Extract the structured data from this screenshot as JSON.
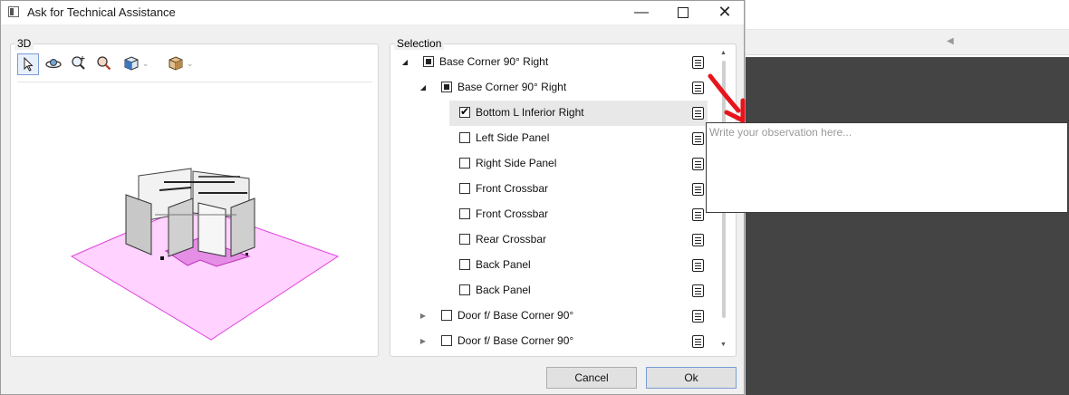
{
  "dialog": {
    "title": "Ask for Technical Assistance",
    "window_controls": [
      "minimize-icon",
      "maximize-icon",
      "close-icon"
    ]
  },
  "panel3d": {
    "label": "3D",
    "tools": [
      "select-pointer-icon",
      "orbit-icon",
      "zoom-extents-icon",
      "zoom-icon",
      "view-cube-icon",
      "box-view-icon"
    ]
  },
  "selection": {
    "label": "Selection",
    "items": [
      {
        "label": "Base Corner 90° Right",
        "level": 0,
        "expander": "expanded",
        "check": "partial"
      },
      {
        "label": "Base Corner 90° Right",
        "level": 1,
        "expander": "expanded",
        "check": "partial"
      },
      {
        "label": "Bottom L Inferior Right",
        "level": 2,
        "expander": "none",
        "check": "checked",
        "selected": true
      },
      {
        "label": "Left Side Panel",
        "level": 2,
        "expander": "none",
        "check": "unchecked"
      },
      {
        "label": "Right Side Panel",
        "level": 2,
        "expander": "none",
        "check": "unchecked"
      },
      {
        "label": "Front Crossbar",
        "level": 2,
        "expander": "none",
        "check": "unchecked"
      },
      {
        "label": "Front Crossbar",
        "level": 2,
        "expander": "none",
        "check": "unchecked"
      },
      {
        "label": "Rear Crossbar",
        "level": 2,
        "expander": "none",
        "check": "unchecked"
      },
      {
        "label": "Back Panel",
        "level": 2,
        "expander": "none",
        "check": "unchecked"
      },
      {
        "label": "Back Panel",
        "level": 2,
        "expander": "none",
        "check": "unchecked"
      },
      {
        "label": "Door f/ Base Corner 90°",
        "level": 1,
        "expander": "collapsed",
        "check": "unchecked"
      },
      {
        "label": "Door f/ Base Corner 90°",
        "level": 1,
        "expander": "collapsed",
        "check": "unchecked"
      }
    ]
  },
  "observation": {
    "placeholder": "Write your observation here...",
    "value": ""
  },
  "buttons": {
    "cancel": "Cancel",
    "ok": "Ok"
  },
  "colors": {
    "annotation_arrow": "#e8141c",
    "floor_fill": "#ffd2ff",
    "floor_stroke": "#e040e0",
    "selected_row": "#e8e8e8"
  }
}
